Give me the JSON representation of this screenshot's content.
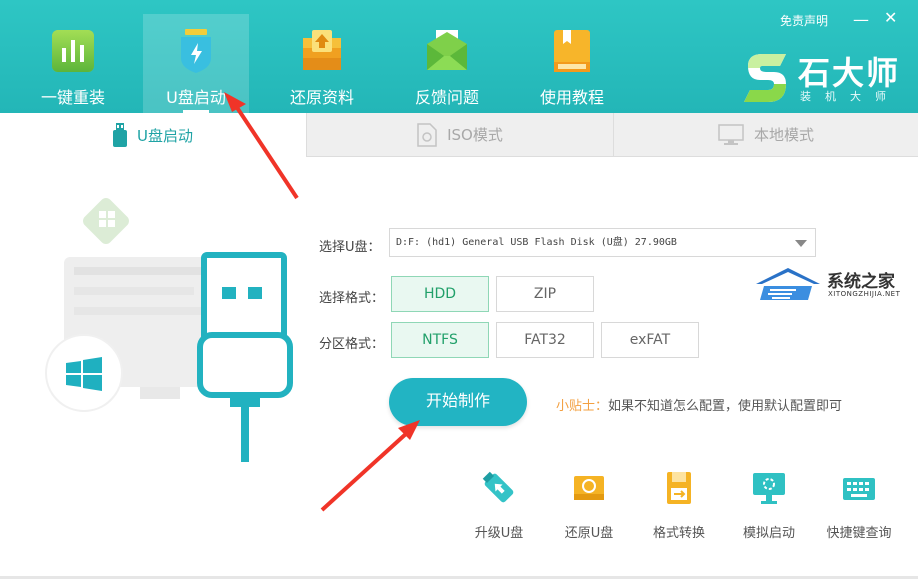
{
  "header": {
    "nav": [
      {
        "label": "一键重装",
        "icon": "chart-bars-icon"
      },
      {
        "label": "U盘启动",
        "icon": "usb-shield-icon"
      },
      {
        "label": "还原资料",
        "icon": "restore-box-icon"
      },
      {
        "label": "反馈问题",
        "icon": "mail-icon"
      },
      {
        "label": "使用教程",
        "icon": "book-icon"
      }
    ],
    "disclaimer": "免责声明",
    "minimize": "—",
    "close": "✕",
    "logo_text": "石大师",
    "logo_sub": "装机大师"
  },
  "tabs": [
    {
      "label": "U盘启动",
      "icon": "usb-drive-icon"
    },
    {
      "label": "ISO模式",
      "icon": "iso-file-icon"
    },
    {
      "label": "本地模式",
      "icon": "monitor-icon"
    }
  ],
  "form": {
    "select_label": "选择U盘：",
    "select_value": "D:F: (hd1) General USB Flash Disk  (U盘) 27.90GB",
    "format_label": "选择格式：",
    "format_options": [
      "HDD",
      "ZIP"
    ],
    "partition_label": "分区格式：",
    "partition_options": [
      "NTFS",
      "FAT32",
      "exFAT"
    ]
  },
  "start_button": "开始制作",
  "tip": {
    "key": "小贴士：",
    "text": "如果不知道怎么配置，使用默认配置即可"
  },
  "watermark": {
    "text": "系统之家",
    "sub": "XITONGZHIJIA.NET"
  },
  "tools": [
    {
      "label": "升级U盘",
      "icon": "usb-upgrade-icon"
    },
    {
      "label": "还原U盘",
      "icon": "usb-restore-icon"
    },
    {
      "label": "格式转换",
      "icon": "format-convert-icon"
    },
    {
      "label": "模拟启动",
      "icon": "simulate-boot-icon"
    },
    {
      "label": "快捷键查询",
      "icon": "keyboard-icon"
    }
  ],
  "colors": {
    "accent": "#22b4c3",
    "header": "#2ec6c4",
    "selected": "#21a06a",
    "tip": "#f3a041"
  }
}
